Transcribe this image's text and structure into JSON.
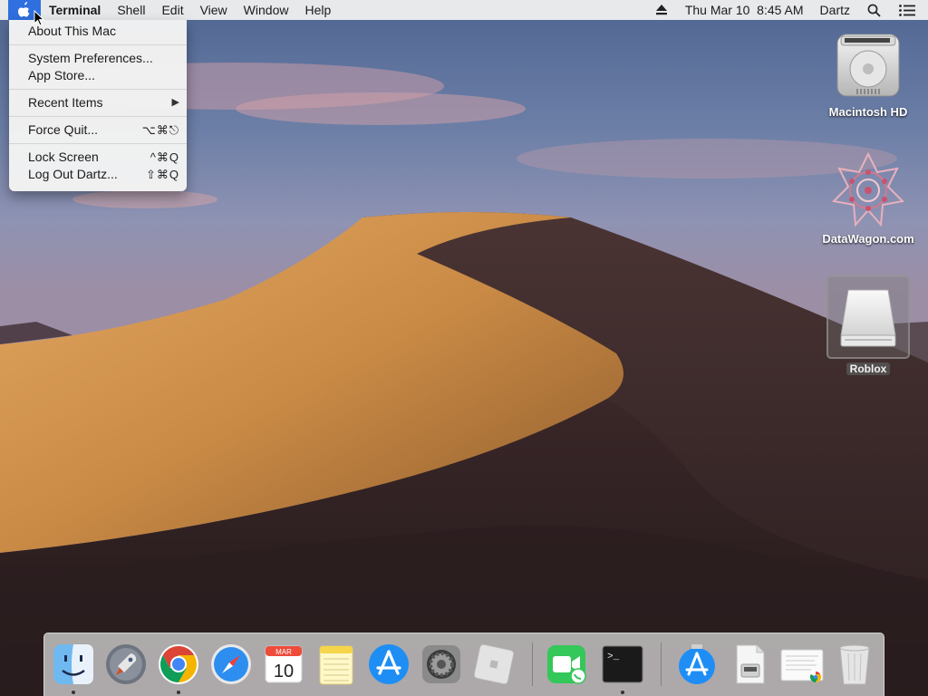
{
  "menubar": {
    "app_name": "Terminal",
    "menus": [
      "Shell",
      "Edit",
      "View",
      "Window",
      "Help"
    ],
    "clock": "Thu Mar 10  8:45 AM",
    "user": "Dartz",
    "icons": [
      "apple-icon",
      "eject-icon",
      "spotlight-search-icon",
      "notification-center-icon"
    ]
  },
  "apple_menu": {
    "about": "About This Mac",
    "system_prefs": "System Preferences...",
    "app_store": "App Store...",
    "recent_items": "Recent Items",
    "recent_arrow": "▶",
    "force_quit": "Force Quit...",
    "force_quit_shortcut": "⌥⌘⎋",
    "lock_screen": "Lock Screen",
    "lock_screen_shortcut": "^⌘Q",
    "log_out": "Log Out Dartz...",
    "log_out_shortcut": "⇧⌘Q"
  },
  "desktop_icons": {
    "hd": "Macintosh HD",
    "datawagon": "DataWagon.com",
    "roblox": "Roblox"
  },
  "dock": {
    "apps": [
      "Finder",
      "Launchpad",
      "Google Chrome",
      "Safari",
      "Calendar",
      "Notes",
      "App Store",
      "System Preferences",
      "Roblox",
      "FaceTime",
      "Terminal",
      "App Store Downloads",
      "Disk Image",
      "Document"
    ],
    "calendar_month": "MAR",
    "calendar_day": "10",
    "terminal_prompt": ">_"
  },
  "colors": {
    "menu_highlight": "#2f6fe0",
    "dune": "#c98a45"
  }
}
